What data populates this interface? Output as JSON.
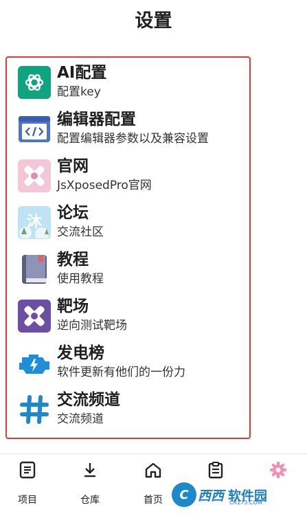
{
  "header": {
    "title": "设置"
  },
  "settings": {
    "items": [
      {
        "title": "AI配置",
        "subtitle": "配置key",
        "icon": "openai-icon"
      },
      {
        "title": "编辑器配置",
        "subtitle": "配置编辑器参数以及兼容设置",
        "icon": "code-editor-icon"
      },
      {
        "title": "官网",
        "subtitle": "JsXposedPro官网",
        "icon": "bandage-icon"
      },
      {
        "title": "论坛",
        "subtitle": "交流社区",
        "icon": "forum-icon"
      },
      {
        "title": "教程",
        "subtitle": "使用教程",
        "icon": "book-icon"
      },
      {
        "title": "靶场",
        "subtitle": "逆向测试靶场",
        "icon": "bandage-purple-icon"
      },
      {
        "title": "发电榜",
        "subtitle": "软件更新有他们的一份力",
        "icon": "engine-icon"
      },
      {
        "title": "交流频道",
        "subtitle": "交流频道",
        "icon": "hashtag-icon"
      }
    ]
  },
  "bottom_nav": {
    "items": [
      {
        "label": "项目",
        "icon": "document-icon"
      },
      {
        "label": "仓库",
        "icon": "download-icon"
      },
      {
        "label": "首页",
        "icon": "home-icon"
      },
      {
        "label": "",
        "icon": "clipboard-icon"
      },
      {
        "label": "",
        "icon": "gear-icon",
        "active": true
      }
    ]
  },
  "watermark": {
    "badge": "C",
    "text1": "西西",
    "text2": "软件园",
    "sub": "CR173.COM"
  },
  "colors": {
    "highlight_border": "#e53935",
    "active_tab": "#f48fb1",
    "openai_green": "#10a37f"
  }
}
